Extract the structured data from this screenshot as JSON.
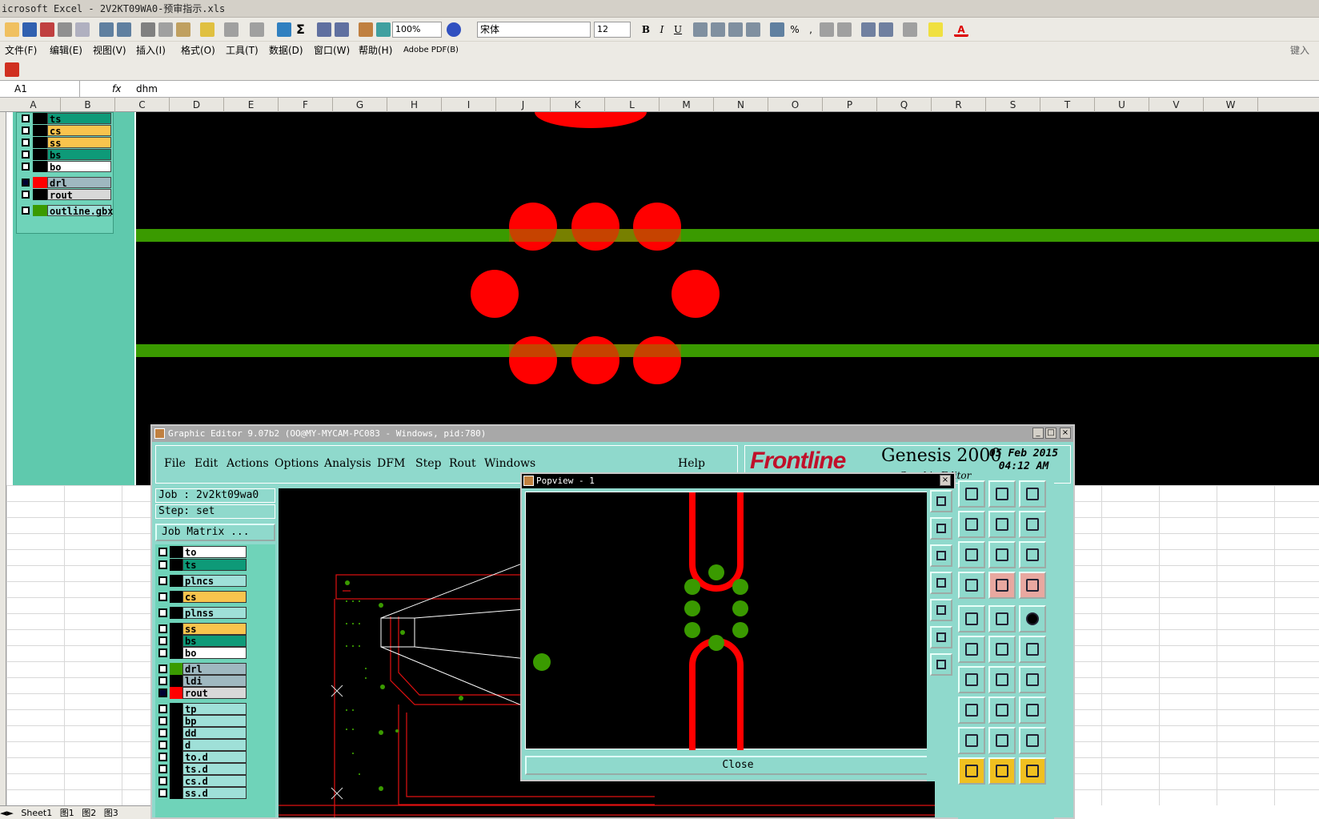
{
  "excel": {
    "title": "icrosoft Excel - 2V2KT09WA0-预审指示.xls",
    "zoom": "100%",
    "font_name": "宋体",
    "font_size": "12",
    "menu": [
      "文件(F)",
      "编辑(E)",
      "视图(V)",
      "插入(I)",
      "格式(O)",
      "工具(T)",
      "数据(D)",
      "窗口(W)",
      "帮助(H)",
      "Adobe PDF(B)"
    ],
    "ask_box": "键入",
    "name_box": "A1",
    "fx": "fx",
    "formula_value": "dhm",
    "columns": [
      "A",
      "B",
      "C",
      "D",
      "E",
      "F",
      "G",
      "H",
      "I",
      "J",
      "K",
      "L",
      "M",
      "N",
      "O",
      "P",
      "Q",
      "R",
      "S",
      "T",
      "U",
      "V",
      "W"
    ],
    "sheet_tabs": [
      "Sheet1",
      "图1",
      "图2",
      "图3"
    ]
  },
  "bg_layers": [
    {
      "name": "ts",
      "color": "#0e9a78"
    },
    {
      "name": "cs",
      "color": "#f9c44d"
    },
    {
      "name": "ss",
      "color": "#f9c44d"
    },
    {
      "name": "bs",
      "color": "#0e9a78"
    },
    {
      "name": "bo",
      "color": "#ffffff"
    },
    {
      "name": "drl",
      "color": "#9fb8c0"
    },
    {
      "name": "rout",
      "color": "#d8d8d8"
    },
    {
      "name": "outline.gbx",
      "color": "#9fe0d8"
    }
  ],
  "editor": {
    "title": "Graphic Editor 9.07b2 (OO@MY-MYCAM-PC083 - Windows, pid:780)",
    "menu": [
      "File",
      "Edit",
      "Actions",
      "Options",
      "Analysis",
      "DFM",
      "Step",
      "Rout",
      "Windows"
    ],
    "help": "Help",
    "logo_brand": "Frontline",
    "logo_product": "Genesis 2000",
    "logo_sub": "Graphic Editor",
    "date": "05 Feb 2015",
    "time": "04:12 AM",
    "job": "Job : 2v2kt09wa0",
    "step": "Step: set",
    "job_matrix": "Job Matrix ...",
    "layers": [
      {
        "name": "to",
        "color": "#ffffff"
      },
      {
        "name": "ts",
        "color": "#0e9a78"
      },
      {
        "name": "plncs",
        "color": "#9fe0d8"
      },
      {
        "name": "cs",
        "color": "#f9c44d"
      },
      {
        "name": "plnss",
        "color": "#9fe0d8"
      },
      {
        "name": "ss",
        "color": "#f9c44d"
      },
      {
        "name": "bs",
        "color": "#0e9a78"
      },
      {
        "name": "bo",
        "color": "#ffffff"
      },
      {
        "name": "drl",
        "color": "#9fb8c0"
      },
      {
        "name": "ldi",
        "color": "#9fb8c0"
      },
      {
        "name": "rout",
        "color": "#d8d8d8"
      },
      {
        "name": "tp",
        "color": "#9fe0d8"
      },
      {
        "name": "bp",
        "color": "#9fe0d8"
      },
      {
        "name": "dd",
        "color": "#9fe0d8"
      },
      {
        "name": "d",
        "color": "#9fe0d8"
      },
      {
        "name": "to.d",
        "color": "#9fe0d8"
      },
      {
        "name": "ts.d",
        "color": "#9fe0d8"
      },
      {
        "name": "cs.d",
        "color": "#9fe0d8"
      },
      {
        "name": "ss.d",
        "color": "#9fe0d8"
      }
    ]
  },
  "popview": {
    "title": "Popview - 1",
    "close": "Close"
  },
  "colors": {
    "pad_red": "#ff0000",
    "trace_green": "#3a9a00",
    "panel_teal": "#8fd9cc"
  }
}
